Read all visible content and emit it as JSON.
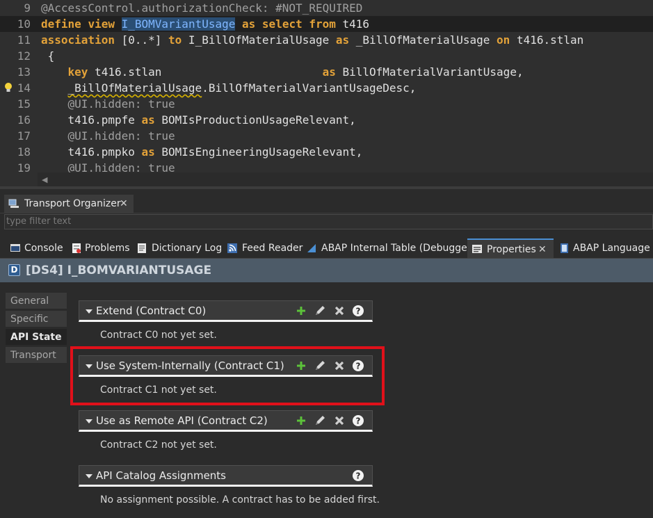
{
  "editor": {
    "lines": [
      {
        "num": "9",
        "parts": [
          {
            "t": "@AccessControl.authorizationCheck: #NOT_REQUIRED",
            "c": "ann"
          }
        ]
      },
      {
        "num": "10",
        "hl": true,
        "parts": [
          {
            "t": "define",
            "c": "kw"
          },
          {
            "t": " "
          },
          {
            "t": "view",
            "c": "kw"
          },
          {
            "t": " "
          },
          {
            "t": "I_BOMVariantUsage",
            "c": "sel"
          },
          {
            "t": " "
          },
          {
            "t": "as",
            "c": "kw"
          },
          {
            "t": " "
          },
          {
            "t": "select",
            "c": "kw"
          },
          {
            "t": " "
          },
          {
            "t": "from",
            "c": "kw"
          },
          {
            "t": " t416"
          }
        ]
      },
      {
        "num": "11",
        "parts": [
          {
            "t": "association",
            "c": "kw"
          },
          {
            "t": " [0..*] "
          },
          {
            "t": "to",
            "c": "kw"
          },
          {
            "t": " I_BillOfMaterialUsage "
          },
          {
            "t": "as",
            "c": "kw"
          },
          {
            "t": " _BillOfMaterialUsage "
          },
          {
            "t": "on",
            "c": "kw"
          },
          {
            "t": " t416.stlan"
          }
        ]
      },
      {
        "num": "12",
        "parts": [
          {
            "t": " {"
          }
        ]
      },
      {
        "num": "13",
        "parts": [
          {
            "t": "    "
          },
          {
            "t": "key",
            "c": "kw"
          },
          {
            "t": " t416.stlan                        "
          },
          {
            "t": "as",
            "c": "kw"
          },
          {
            "t": " BillOfMaterialVariantUsage,"
          }
        ]
      },
      {
        "num": "14",
        "warn": true,
        "parts": [
          {
            "t": "    "
          },
          {
            "t": "_BillOfMaterialUsage",
            "c": "sq"
          },
          {
            "t": ".BillOfMaterialVariantUsageDesc,"
          }
        ]
      },
      {
        "num": "15",
        "parts": [
          {
            "t": "    "
          },
          {
            "t": "@UI.hidden: true",
            "c": "ann"
          }
        ]
      },
      {
        "num": "16",
        "parts": [
          {
            "t": "    t416.pmpfe "
          },
          {
            "t": "as",
            "c": "kw"
          },
          {
            "t": " BOMIsProductionUsageRelevant,"
          }
        ]
      },
      {
        "num": "17",
        "parts": [
          {
            "t": "    "
          },
          {
            "t": "@UI.hidden: true",
            "c": "ann"
          }
        ]
      },
      {
        "num": "18",
        "parts": [
          {
            "t": "    t416.pmpko "
          },
          {
            "t": "as",
            "c": "kw"
          },
          {
            "t": " BOMIsEngineeringUsageRelevant,"
          }
        ]
      },
      {
        "num": "19",
        "parts": [
          {
            "t": "    "
          },
          {
            "t": "@UI.hidden: true",
            "c": "ann"
          }
        ]
      }
    ]
  },
  "transport": {
    "tab_label": "Transport Organizer",
    "filter_placeholder": "type filter text"
  },
  "bottom_tabs": [
    {
      "label": "Console",
      "icon": "console-icon"
    },
    {
      "label": "Problems",
      "icon": "problems-icon"
    },
    {
      "label": "Dictionary Log",
      "icon": "dictionary-log-icon"
    },
    {
      "label": "Feed Reader",
      "icon": "feed-icon"
    },
    {
      "label": "ABAP Internal Table (Debugger)",
      "icon": "abap-table-icon"
    },
    {
      "label": "Properties",
      "icon": "properties-icon",
      "active": true
    },
    {
      "label": "ABAP Language H",
      "icon": "abap-language-icon"
    }
  ],
  "properties": {
    "header_title": "[DS4] I_BOMVARIANTUSAGE",
    "header_icon_letter": "D",
    "nav": [
      "General",
      "Specific",
      "API State",
      "Transport"
    ],
    "active_nav": "API State",
    "sections": [
      {
        "title": "Extend (Contract C0)",
        "message": "Contract C0 not yet set.",
        "actions": [
          "add",
          "edit",
          "delete",
          "help"
        ]
      },
      {
        "title": "Use System-Internally (Contract C1)",
        "message": "Contract C1 not yet set.",
        "actions": [
          "add",
          "edit",
          "delete",
          "help"
        ]
      },
      {
        "title": "Use as Remote API (Contract C2)",
        "message": "Contract C2 not yet set.",
        "actions": [
          "add",
          "edit",
          "delete",
          "help"
        ]
      },
      {
        "title": "API Catalog Assignments",
        "message": "No assignment possible. A contract has to be added first.",
        "actions": [
          "help"
        ]
      }
    ]
  },
  "colors": {
    "keyword": "#e3a239",
    "highlight_border": "#e0101a",
    "add_green": "#5cc23a"
  }
}
